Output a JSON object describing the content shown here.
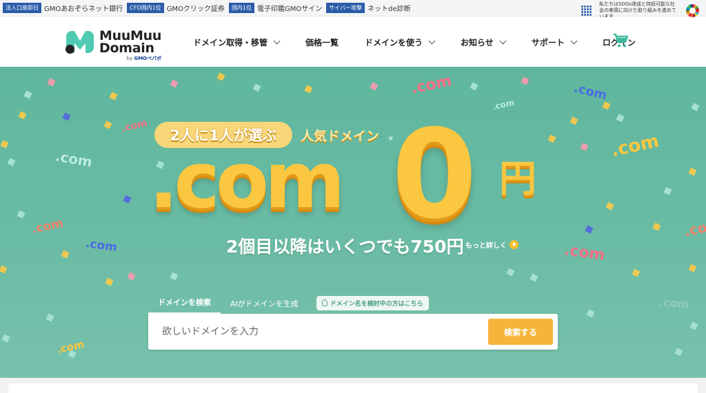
{
  "topbar": {
    "promos": [
      {
        "tag": "法人口座即日",
        "link": "GMOあおぞらネット銀行"
      },
      {
        "tag": "CFD国内1位",
        "link": "GMOクリック証券"
      },
      {
        "tag": "国内1位",
        "link": "電子印鑑GMOサイン"
      },
      {
        "tag": "サイバー攻撃",
        "link": "ネットde診断"
      }
    ],
    "sdgs_text": "私たちはSDGs達成と持続可能な社会の実現に向けた取り組みを進めています"
  },
  "header": {
    "logo_line1": "MuuMuu",
    "logo_line2": "Domain",
    "logo_by": "by",
    "logo_brand": "GMOペパボ",
    "nav": [
      {
        "label": "ドメイン取得・移管",
        "has_dropdown": true
      },
      {
        "label": "価格一覧",
        "has_dropdown": false
      },
      {
        "label": "ドメインを使う",
        "has_dropdown": true
      },
      {
        "label": "お知らせ",
        "has_dropdown": true
      },
      {
        "label": "サポート",
        "has_dropdown": true
      },
      {
        "label": "ログイン",
        "has_dropdown": false
      }
    ],
    "cart_icon": "cart-icon"
  },
  "hero": {
    "pill_text": "2人に1人が選ぶ",
    "popular_text": "人気ドメイン",
    "note_mark": "※",
    "big_domain": ".com",
    "big_zero": "0",
    "big_yen": "円",
    "subline": "2個目以降はいくつでも750円",
    "more_link": "もっと詳しく",
    "decor_text": ".com",
    "colors": {
      "background": "#66b9a0",
      "gold": "#fbc740",
      "accent_button": "#f4b53a"
    }
  },
  "search": {
    "tabs": [
      {
        "label": "ドメインを検索",
        "active": true
      },
      {
        "label": "AIがドメインを生成",
        "active": false
      }
    ],
    "hint": "ドメイン名を検討中の方はこちら",
    "placeholder": "欲しいドメインを入力",
    "value": "",
    "button_label": "検索する"
  }
}
